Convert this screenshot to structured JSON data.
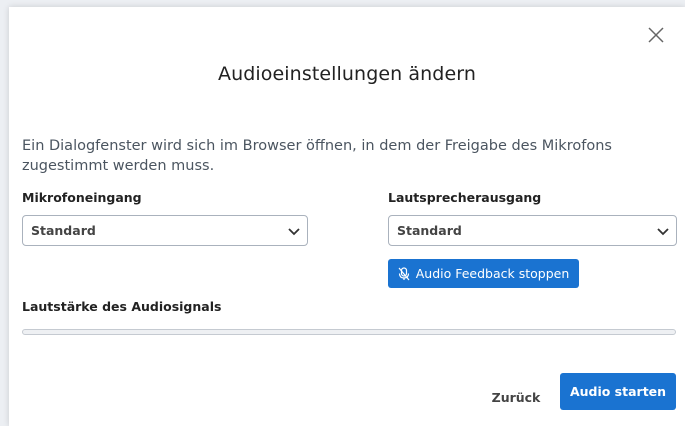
{
  "dialog": {
    "title": "Audioeinstellungen ändern",
    "description": "Ein Dialogfenster wird sich im Browser öffnen, in dem der Freigabe des Mikrofons zugestimmt werden muss.",
    "close_icon": "close-icon"
  },
  "microphone": {
    "label": "Mikrofoneingang",
    "selected": "Standard"
  },
  "speaker": {
    "label": "Lautsprecherausgang",
    "selected": "Standard"
  },
  "feedback_button": {
    "label": "Audio Feedback stoppen",
    "icon": "microphone-muted-icon"
  },
  "volume": {
    "label": "Lautstärke des Audiosignals",
    "level": 0
  },
  "footer": {
    "back_label": "Zurück",
    "start_label": "Audio starten"
  },
  "colors": {
    "accent": "#1a73d1"
  }
}
